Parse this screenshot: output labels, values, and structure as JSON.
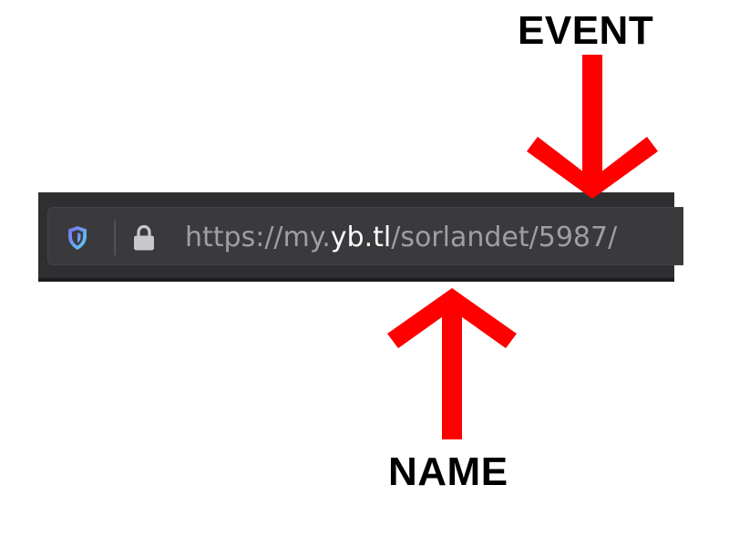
{
  "annotations": {
    "top_label": "EVENT",
    "bottom_label": "NAME",
    "arrow_color": "#ff0000"
  },
  "urlbar": {
    "shield_icon": "shield-icon",
    "lock_icon": "lock-icon",
    "url_scheme": "https://my.",
    "url_host": "yb.tl",
    "url_path": "/sorlandet/5987/"
  },
  "colors": {
    "toolbar_bg": "#2f2f31",
    "urlbar_bg": "#3a3a3d",
    "url_dim_text": "#9e9ea3",
    "url_host_text": "#fbfbfe",
    "shield_gradient_start": "#7a6cf0",
    "shield_gradient_end": "#5fd3f3"
  }
}
